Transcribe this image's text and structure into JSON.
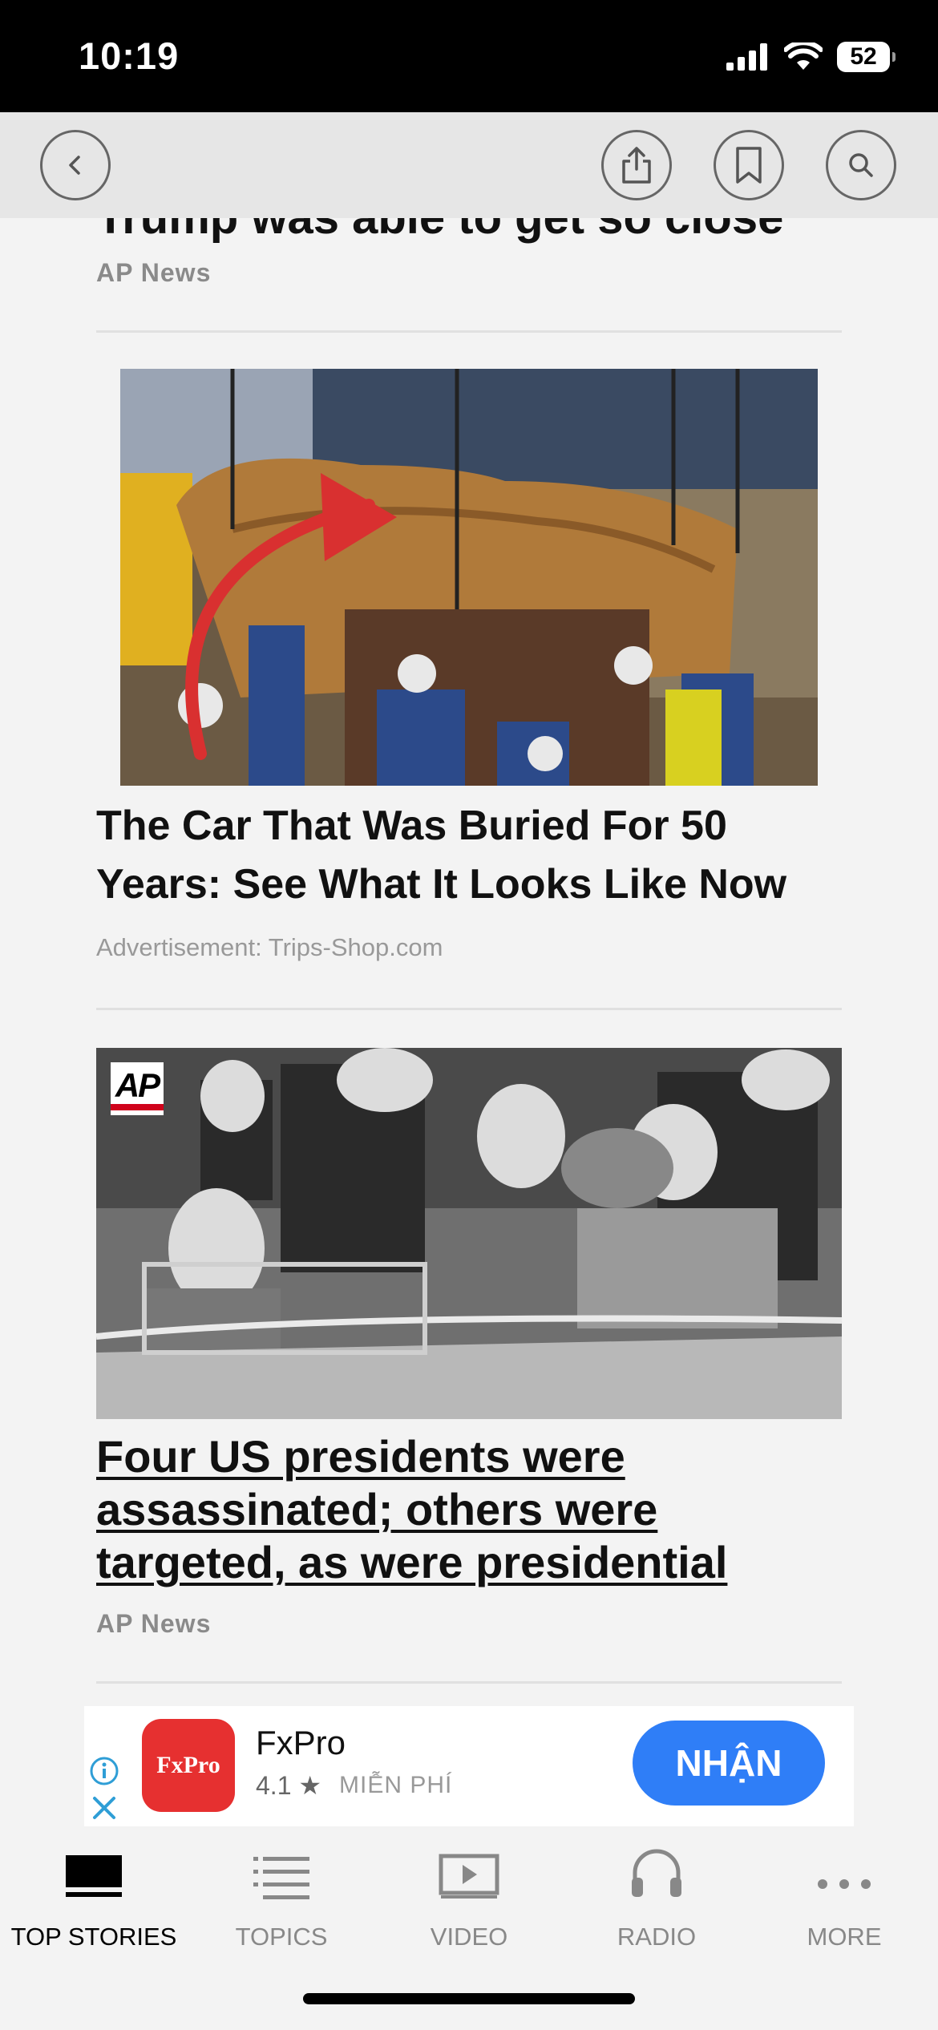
{
  "status_bar": {
    "time": "10:19",
    "battery": "52"
  },
  "top_nav": {
    "back": "back-icon",
    "share": "share-icon",
    "bookmark": "bookmark-icon",
    "search": "search-icon"
  },
  "previous_story": {
    "title_partial": "Trump was able to get so close",
    "source": "AP News"
  },
  "sponsored_story": {
    "title": "The Car That Was Buried For 50 Years: See What It Looks Like Now",
    "source": "Advertisement: Trips-Shop.com"
  },
  "story": {
    "image_badge": "AP",
    "title": "Four US presidents were assassinated; others were targeted, as were presidential",
    "source": "AP News"
  },
  "ad_banner": {
    "app_logo_text": "FxPro",
    "app_name": "FxPro",
    "rating": "4.1 ★",
    "price_label": "MIỄN PHÍ",
    "cta_label": "NHẬN",
    "info_icon": "info-icon",
    "close_icon": "close-icon"
  },
  "tab_bar": {
    "tabs": [
      {
        "label": "TOP STORIES",
        "icon": "top-stories-icon",
        "active": true
      },
      {
        "label": "TOPICS",
        "icon": "topics-list-icon",
        "active": false
      },
      {
        "label": "VIDEO",
        "icon": "video-play-icon",
        "active": false
      },
      {
        "label": "RADIO",
        "icon": "headphones-icon",
        "active": false
      },
      {
        "label": "MORE",
        "icon": "more-dots-icon",
        "active": false
      }
    ]
  },
  "colors": {
    "accent": "#2f7ef7",
    "ad_logo": "#e63030",
    "ap_red": "#d0021b"
  }
}
